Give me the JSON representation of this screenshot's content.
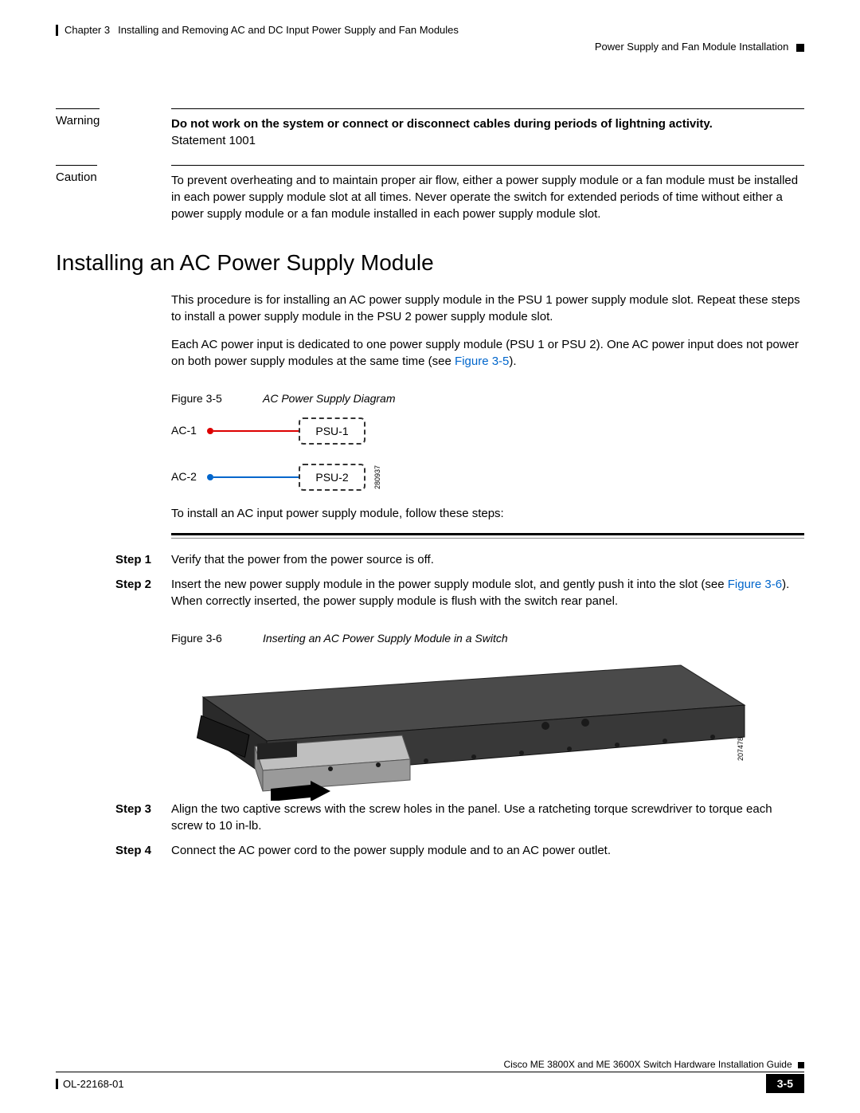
{
  "header": {
    "chapter_label": "Chapter 3",
    "chapter_title": "Installing and Removing AC and DC Input Power Supply and Fan Modules",
    "section_title": "Power Supply and Fan Module Installation"
  },
  "warning": {
    "label": "Warning",
    "text_line1": "Do not work on the system or connect or disconnect cables during periods of lightning activity.",
    "statement": "Statement 1001"
  },
  "caution": {
    "label": "Caution",
    "text": "To prevent overheating and to maintain proper air flow, either a power supply module or a fan module must be installed in each power supply module slot at all times. Never operate the switch for extended periods of time without either a power supply module or a fan module installed in each power supply module slot."
  },
  "heading": "Installing an AC Power Supply Module",
  "intro_p1": "This procedure is for installing an AC power supply module in the PSU 1 power supply module slot. Repeat these steps to install a power supply module in the PSU 2 power supply module slot.",
  "intro_p2_pre": "Each AC power input is dedicated to one power supply module (PSU 1 or PSU 2). One AC power input does not power on both power supply modules at the same time (see ",
  "intro_p2_link": "Figure 3-5",
  "intro_p2_post": ").",
  "figure5": {
    "num": "Figure 3-5",
    "title": "AC Power Supply Diagram",
    "ac1": "AC-1",
    "ac2": "AC-2",
    "psu1": "PSU-1",
    "psu2": "PSU-2",
    "id": "280937"
  },
  "intro_p3": "To install an AC input power supply module, follow these steps:",
  "steps": {
    "s1_label": "Step 1",
    "s1_text": "Verify that the power from the power source is off.",
    "s2_label": "Step 2",
    "s2_text_pre": "Insert the new power supply module in the power supply module slot, and gently push it into the slot (see ",
    "s2_link": "Figure 3-6",
    "s2_text_post": "). When correctly inserted, the power supply module is flush with the switch rear panel.",
    "s3_label": "Step 3",
    "s3_text": "Align the two captive screws with the screw holes in the panel. Use a ratcheting torque screwdriver to torque each screw to 10 in-lb.",
    "s4_label": "Step 4",
    "s4_text": "Connect the AC power cord to the power supply module and to an AC power outlet."
  },
  "figure6": {
    "num": "Figure 3-6",
    "title": "Inserting an AC Power Supply Module in a Switch",
    "id": "207478"
  },
  "footer": {
    "guide": "Cisco ME 3800X and ME 3600X Switch Hardware Installation Guide",
    "docnum": "OL-22168-01",
    "pagenum": "3-5"
  }
}
